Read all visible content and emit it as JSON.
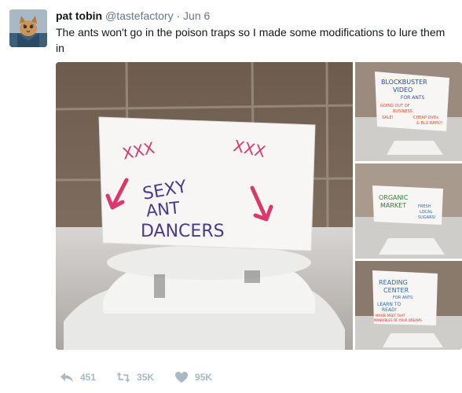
{
  "tweet": {
    "name": "pat tobin",
    "handle": "@tastefactory",
    "separator": "·",
    "date": "Jun 6",
    "text": "The ants won't go in the poison traps so I made some modifications to lure them in"
  },
  "photos": {
    "main_sign": {
      "top": "XXX",
      "top2": "XXX",
      "line1": "SEXY",
      "line2": "ANT",
      "line3": "DANCERS"
    },
    "sign_1": {
      "line1": "BLOCKBUSTER",
      "line2": "VIDEO",
      "line3": "FOR ANTS",
      "extra1": "GOING OUT OF",
      "extra2": "BUSINESS",
      "extra3": "SALE!",
      "extra4": "CHEAP DVDs",
      "extra5": "& BLU RAYS!!"
    },
    "sign_2": {
      "line1": "ORGANIC",
      "line2": "MARKET",
      "extra1": "FRESH",
      "extra2": "LOCAL",
      "extra3": "SUGARS!"
    },
    "sign_3": {
      "line1": "READING",
      "line2": "CENTER",
      "line3": "FOR ANTS",
      "extra1": "LEARN TO",
      "extra2": "READ!",
      "extra3": "MAYBE MEET THAT",
      "extra4": "MANDIBLES OF YOUR DREAMS"
    }
  },
  "actions": {
    "reply_count": "451",
    "retweet_count": "35K",
    "like_count": "95K"
  },
  "colors": {
    "link_gray": "#657786",
    "action_gray": "#aab8c2",
    "text": "#14171a"
  },
  "icons": [
    "reply-icon",
    "retweet-icon",
    "heart-icon"
  ]
}
